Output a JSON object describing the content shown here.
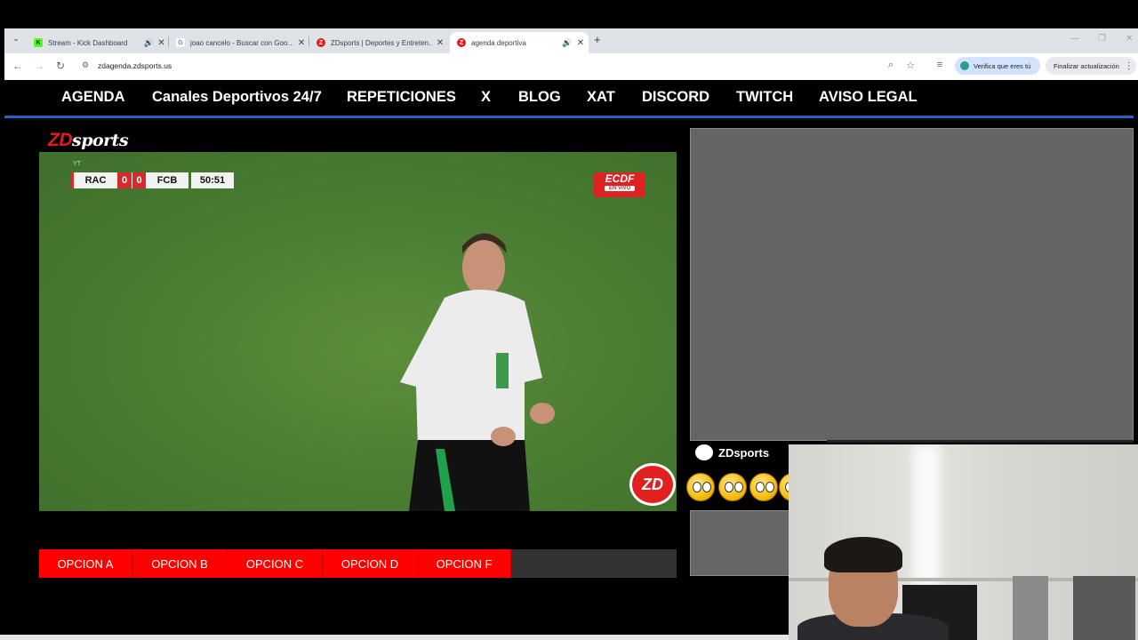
{
  "browser": {
    "tabs": [
      {
        "title": "Stream - Kick Dashboard",
        "audio": "🔊",
        "close": "✕",
        "fav_color": "#53fc18",
        "fav_text": "K"
      },
      {
        "title": "joao cancelo - Buscar con Goo…",
        "audio": "",
        "close": "✕",
        "fav_color": "#ffffff",
        "fav_text": "G"
      },
      {
        "title": "ZDsports | Deportes y Entreten…",
        "audio": "",
        "close": "✕",
        "fav_color": "#e51b1b",
        "fav_text": "Z"
      },
      {
        "title": "agenda deportiva",
        "audio": "🔊",
        "close": "✕",
        "fav_color": "#e51b1b",
        "fav_text": "Z"
      }
    ],
    "new_tab": "+",
    "tab_menu": "⌄",
    "url": "zdagenda.zdsports.us",
    "verify_label": "Verifica que eres tú",
    "finish_label": "Finalizar actualización",
    "menu_dots": "⋮",
    "window_controls": [
      "—",
      "❐",
      "✕"
    ]
  },
  "nav": {
    "items": [
      "AGENDA",
      "Canales Deportivos 24/7",
      "REPETICIONES",
      "X",
      "BLOG",
      "XAT",
      "DISCORD",
      "TWITCH",
      "AVISO LEGAL"
    ]
  },
  "logo": {
    "zd": "ZD",
    "sports": "sports"
  },
  "video": {
    "watermark": "YT",
    "scorebug": {
      "home": "RAC",
      "home_score": "0",
      "away_score": "0",
      "away": "FCB",
      "clock": "50:51"
    },
    "broadcaster": {
      "name": "ECDF",
      "live": "EN VIVO"
    },
    "badge": "ZD"
  },
  "options": [
    "OPCION A",
    "OPCION B",
    "OPCION C",
    "OPCION D",
    "OPCION F"
  ],
  "chat": {
    "name": "ZDsports"
  }
}
